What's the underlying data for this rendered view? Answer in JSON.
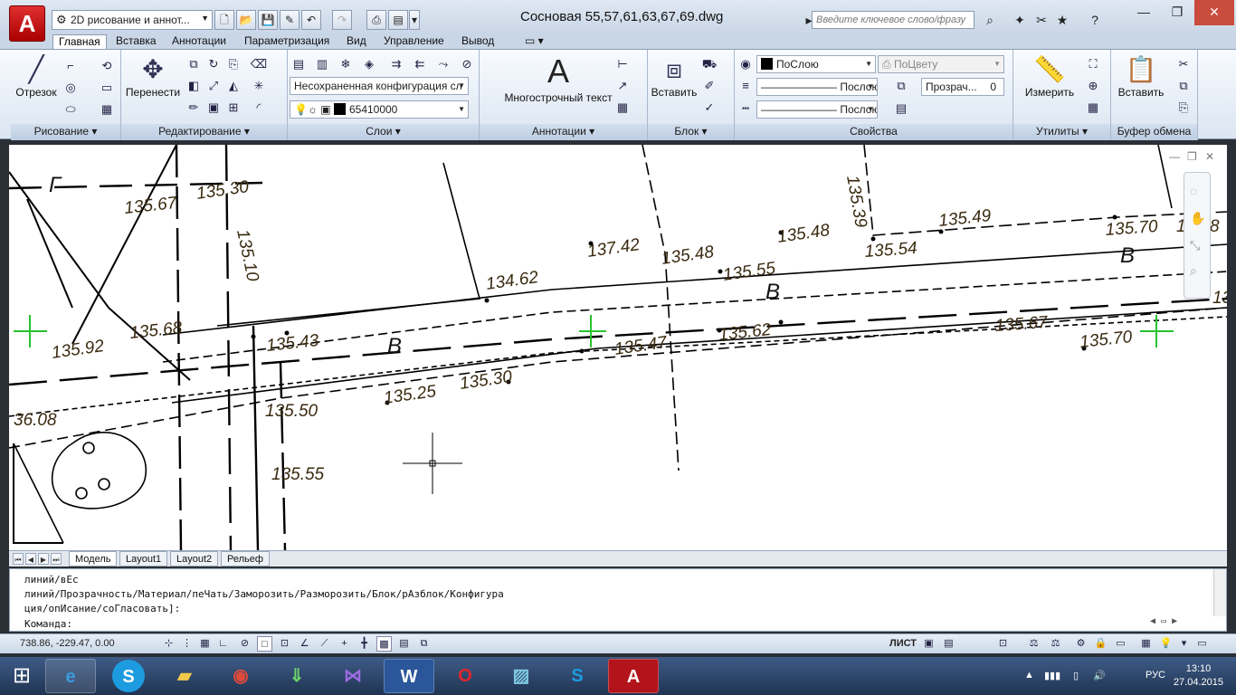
{
  "app": {
    "logo_letter": "A",
    "workspace": "2D рисование и аннот...",
    "document_title": "Сосновая 55,57,61,63,67,69.dwg",
    "help_search_placeholder": "Введите ключевое слово/фразу"
  },
  "ribbon_tabs": [
    "Главная",
    "Вставка",
    "Аннотации",
    "Параметризация",
    "Вид",
    "Управление",
    "Вывод"
  ],
  "panels": {
    "draw": {
      "title": "Рисование",
      "line_label": "Отрезок"
    },
    "modify": {
      "title": "Редактирование",
      "move_label": "Перенести"
    },
    "layers": {
      "title": "Слои",
      "layer_state": "Несохраненная конфигурация сл",
      "current_layer": "65410000"
    },
    "annotation": {
      "title": "Аннотации",
      "mtext_label": "Многострочный текст",
      "mtext_glyph": "A"
    },
    "block": {
      "title": "Блок",
      "insert_label": "Вставить"
    },
    "properties": {
      "title": "Свойства",
      "color": "ПоСлою",
      "plot_style": "ПоЦвету",
      "lineweight": "Послою",
      "linetype": "Послою",
      "transparency_label": "Прозрач...",
      "transparency_value": "0"
    },
    "utilities": {
      "title": "Утилиты",
      "measure_label": "Измерить"
    },
    "clipboard": {
      "title": "Буфер обмена",
      "paste_label": "Вставить"
    }
  },
  "drawing": {
    "elevations": [
      "135.30",
      "135.67",
      "135.10",
      "135.92",
      "135.68",
      "135.43",
      "134.62",
      "137.42",
      "135.48",
      "135.55",
      "135.48",
      "135.39",
      "135.54",
      "135.49",
      "135.70",
      "135.8",
      "135.47",
      "135.62",
      "135.25",
      "135.30",
      "135.50",
      "135.55",
      "135.67",
      "135.70",
      "36.08",
      "13"
    ],
    "road_letters": [
      "В",
      "В",
      "В",
      "Г"
    ]
  },
  "layout_tabs": [
    "Модель",
    "Layout1",
    "Layout2",
    "Рельеф"
  ],
  "command_line": {
    "history": [
      "линий/вЕс",
      "линий/Прозрачность/Материал/пеЧать/Заморозить/Разморозить/Блок/рАзблок/Конфигура",
      "ция/опИсание/соГласовать]:"
    ],
    "prompt": "Команда:"
  },
  "status": {
    "coordinates": "738.86, -229.47, 0.00",
    "sheet": "ЛИСТ"
  },
  "taskbar": {
    "language": "РУС",
    "time": "13:10",
    "date": "27.04.2015"
  },
  "colors": {
    "accent_red": "#c8161d",
    "ribbon_bg": "#dbe5f1",
    "text_brown": "#3a2a10"
  }
}
